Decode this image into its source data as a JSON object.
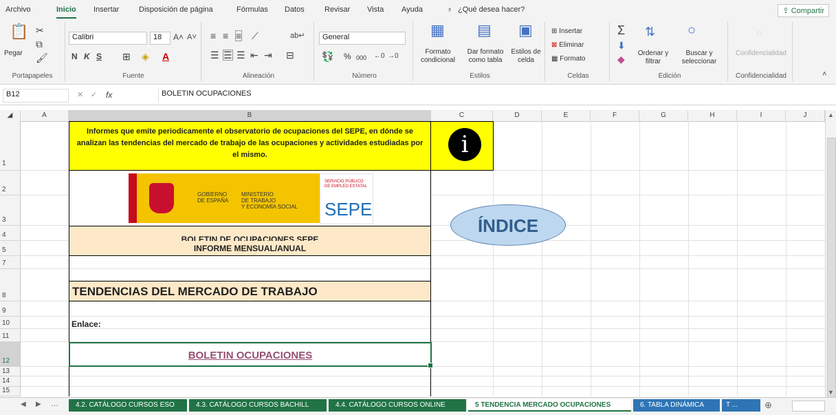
{
  "ribbon_tabs": [
    "Archivo",
    "Inicio",
    "Insertar",
    "Disposición de página",
    "Fórmulas",
    "Datos",
    "Revisar",
    "Vista",
    "Ayuda"
  ],
  "tell_me": "¿Qué desea hacer?",
  "share_label": "Compartir",
  "clipboard": {
    "paste": "Pegar",
    "group": "Portapapeles"
  },
  "font": {
    "name": "Calibri",
    "size": "18",
    "bold": "N",
    "italic": "K",
    "underline": "S",
    "group": "Fuente"
  },
  "alignment": {
    "group": "Alineación"
  },
  "number": {
    "format": "General",
    "percent": "%",
    "thousands": "000",
    "group": "Número"
  },
  "styles": {
    "cond_line1": "Formato",
    "cond_line2": "condicional",
    "table_line1": "Dar formato",
    "table_line2": "como tabla",
    "cell_line1": "Estilos de",
    "cell_line2": "celda",
    "group": "Estilos"
  },
  "cells": {
    "insert": "Insertar",
    "delete": "Eliminar",
    "format": "Formato",
    "group": "Celdas"
  },
  "editing": {
    "sort_line1": "Ordenar y",
    "sort_line2": "filtrar",
    "find_line1": "Buscar y",
    "find_line2": "seleccionar",
    "group": "Edición"
  },
  "confidential": {
    "label": "Confidencialidad",
    "group": "Confidencialidad"
  },
  "formula_bar": {
    "name_box": "B12",
    "fx": "fx",
    "content": "BOLETIN OCUPACIONES"
  },
  "columns": [
    "A",
    "B",
    "C",
    "D",
    "E",
    "F",
    "G",
    "H",
    "I",
    "J"
  ],
  "rows": [
    "1",
    "2",
    "3",
    "4",
    "5",
    "7",
    "8",
    "9",
    "10",
    "11",
    "12",
    "13",
    "14",
    "15"
  ],
  "sheet": {
    "info_text": "Informes que emite periodicamente el observatorio de ocupaciones del SEPE, en dónde se analizan las tendencias del mercado de trabajo de las ocupaciones y actividades estudiadas por el mismo.",
    "info_icon": "i",
    "logo": {
      "gob1": "GOBIERNO",
      "gob2": "DE ESPAÑA",
      "min1": "MINISTERIO",
      "min2": "DE TRABAJO",
      "min3": "Y ECONOMÍA SOCIAL",
      "sep1": "SERVICIO PÚBLICO",
      "sep2": "DE EMPLEO ESTATAL",
      "sepe": "SEPE"
    },
    "indice": "ÍNDICE",
    "title1": "BOLETIN DE OCUPACIONES SEPE",
    "title2": "INFORME MENSUAL/ANUAL",
    "heading": "TENDENCIAS DEL MERCADO DE TRABAJO",
    "link_label": "Enlace:",
    "link_text": "BOLETIN OCUPACIONES"
  },
  "sheet_tabs": [
    "4.2. CATÁLOGO CURSOS ESO",
    "4.3. CATÁLOGO CURSOS BACHILL",
    "4.4. CATÁLOGO CURSOS ONLINE",
    "5 TENDENCIA MERCADO OCUPACIONES",
    "6. TABLA DINÁMICA",
    "T ..."
  ],
  "colors": {
    "excel_green": "#217346",
    "yellow": "#ffff00",
    "peach": "#fde9c8",
    "indice_fill": "#bdd7ee",
    "indice_text": "#2f5e8c",
    "link": "#954f72"
  }
}
